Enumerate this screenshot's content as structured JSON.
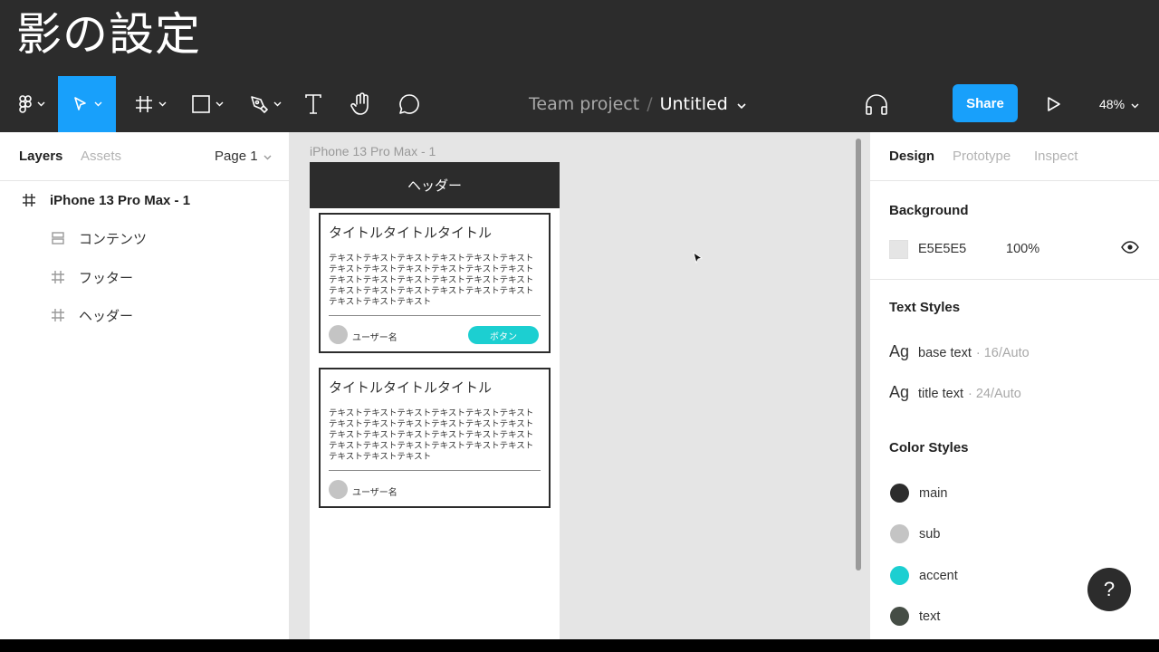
{
  "slide_title": "影の設定",
  "toolbar": {
    "breadcrumb_project": "Team project",
    "breadcrumb_separator": "/",
    "breadcrumb_file": "Untitled",
    "share_label": "Share",
    "zoom": "48%"
  },
  "left_panel": {
    "tab_layers": "Layers",
    "tab_assets": "Assets",
    "page": "Page 1",
    "layers": [
      {
        "name": "iPhone 13 Pro Max - 1",
        "icon": "frame-icon"
      },
      {
        "name": "コンテンツ",
        "icon": "auto-layout-icon"
      },
      {
        "name": "フッター",
        "icon": "frame-icon"
      },
      {
        "name": "ヘッダー",
        "icon": "frame-icon"
      }
    ]
  },
  "canvas": {
    "frame_label": "iPhone 13 Pro Max - 1",
    "header_text": "ヘッダー",
    "cards": [
      {
        "title": "タイトルタイトルタイトル",
        "body": "テキストテキストテキストテキストテキストテキストテキストテキストテキストテキストテキストテキストテキストテキストテキストテキストテキストテキストテキストテキストテキストテキストテキストテキストテキストテキストテキスト",
        "user": "ユーザー名",
        "button": "ボタン"
      },
      {
        "title": "タイトルタイトルタイトル",
        "body": "テキストテキストテキストテキストテキストテキストテキストテキストテキストテキストテキストテキストテキストテキストテキストテキストテキストテキストテキストテキストテキストテキストテキストテキストテキストテキストテキスト",
        "user": "ユーザー名"
      }
    ]
  },
  "right_panel": {
    "tab_design": "Design",
    "tab_prototype": "Prototype",
    "tab_inspect": "Inspect",
    "background_title": "Background",
    "background_hex": "E5E5E5",
    "background_opacity": "100%",
    "text_styles_title": "Text Styles",
    "text_styles": [
      {
        "ag": "Ag",
        "name": "base text",
        "meta": "· 16/Auto"
      },
      {
        "ag": "Ag",
        "name": "title text",
        "meta": "· 24/Auto"
      }
    ],
    "color_styles_title": "Color Styles",
    "color_styles": [
      {
        "name": "main",
        "color": "#2c2c2c"
      },
      {
        "name": "sub",
        "color": "#c4c4c4"
      },
      {
        "name": "accent",
        "color": "#1ccfd1"
      },
      {
        "name": "text",
        "color": "#454d45"
      }
    ],
    "help": "?"
  },
  "colors": {
    "accent_blue": "#18a0fb",
    "toolbar_bg": "#2c2c2c",
    "canvas_bg": "#e5e5e5"
  }
}
